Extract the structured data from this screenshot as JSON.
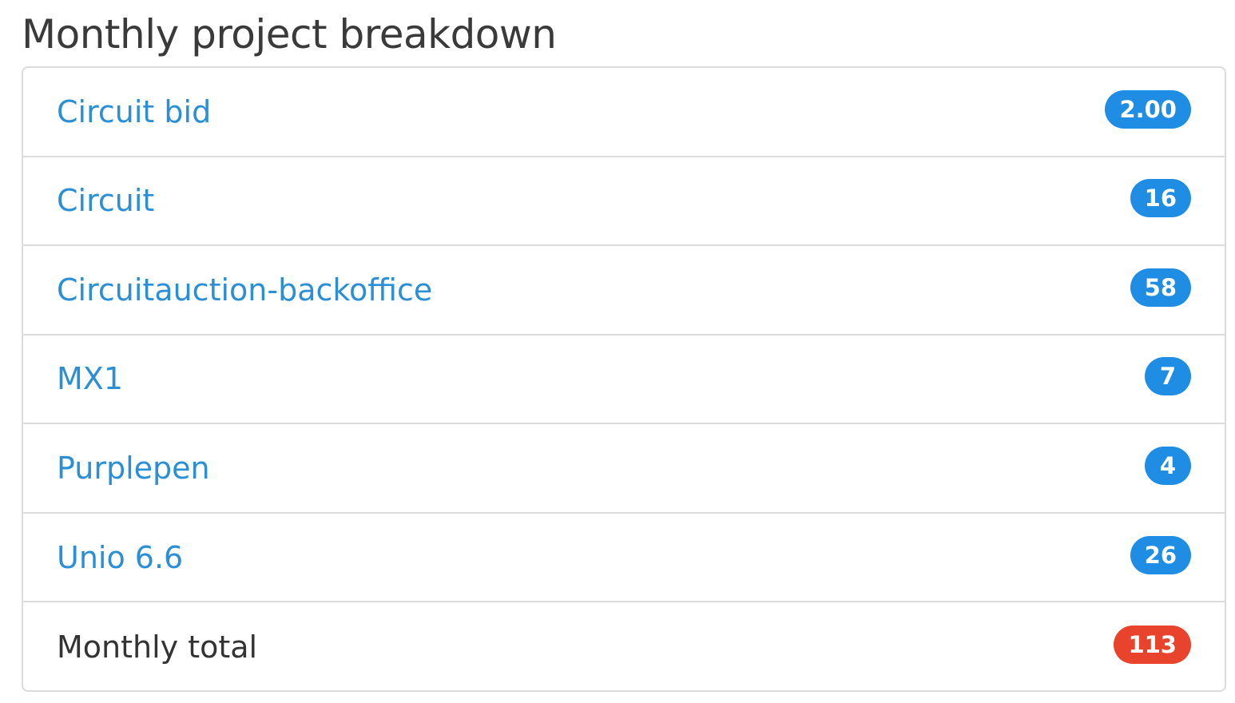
{
  "title": "Monthly project breakdown",
  "projects": [
    {
      "name": "Circuit bid",
      "count": "2.00"
    },
    {
      "name": "Circuit",
      "count": "16"
    },
    {
      "name": "Circuitauction-backoffice",
      "count": "58"
    },
    {
      "name": "MX1",
      "count": "7"
    },
    {
      "name": "Purplepen",
      "count": "4"
    },
    {
      "name": "Unio 6.6",
      "count": "26"
    }
  ],
  "total": {
    "label": "Monthly total",
    "count": "113"
  },
  "colors": {
    "link": "#2b8fd6",
    "badge": "#1f8de3",
    "total_badge": "#e8442d",
    "border": "#dcdcdc",
    "title": "#3a3a3a"
  }
}
